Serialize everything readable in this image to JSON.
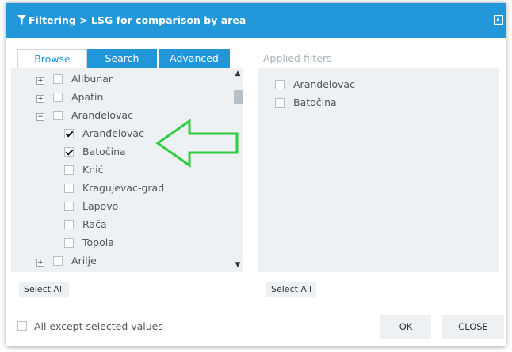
{
  "dialog": {
    "title": "Filtering > LSG for comparison by area"
  },
  "tabs": [
    {
      "label": "Browse",
      "active": true
    },
    {
      "label": "Search",
      "active": false
    },
    {
      "label": "Advanced",
      "active": false
    }
  ],
  "tree": [
    {
      "label": "Alibunar",
      "level": 0,
      "expander": "+",
      "checked": false
    },
    {
      "label": "Apatin",
      "level": 0,
      "expander": "+",
      "checked": false
    },
    {
      "label": "Aranđelovac",
      "level": 0,
      "expander": "−",
      "checked": false
    },
    {
      "label": "Aranđelovac",
      "level": 1,
      "expander": "",
      "checked": true
    },
    {
      "label": "Batočina",
      "level": 1,
      "expander": "",
      "checked": true
    },
    {
      "label": "Knić",
      "level": 1,
      "expander": "",
      "checked": false
    },
    {
      "label": "Kragujevac-grad",
      "level": 1,
      "expander": "",
      "checked": false
    },
    {
      "label": "Lapovo",
      "level": 1,
      "expander": "",
      "checked": false
    },
    {
      "label": "Rača",
      "level": 1,
      "expander": "",
      "checked": false
    },
    {
      "label": "Topola",
      "level": 1,
      "expander": "",
      "checked": false
    },
    {
      "label": "Arilje",
      "level": 0,
      "expander": "+",
      "checked": false
    }
  ],
  "applied": {
    "title": "Applied filters",
    "items": [
      "Aranđelovac",
      "Batočina"
    ]
  },
  "buttons": {
    "select_all_left": "Select All",
    "select_all_right": "Select All",
    "ok": "OK",
    "close": "CLOSE"
  },
  "except_label": "All except selected values",
  "colors": {
    "accent": "#2196d8",
    "panel": "#eef1f4",
    "arrow": "#2ecc40"
  },
  "icons": {
    "title": "filter-icon",
    "restore": "restore-icon",
    "arrow": "left-arrow-annotation"
  }
}
